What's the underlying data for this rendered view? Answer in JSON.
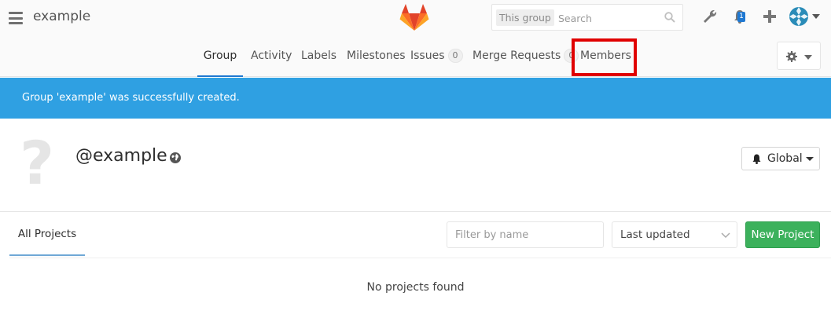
{
  "header": {
    "group_title": "example",
    "search": {
      "scope": "This group",
      "placeholder": "Search"
    },
    "todos_count": "1"
  },
  "subnav": {
    "tabs": [
      {
        "label": "Group",
        "active": true
      },
      {
        "label": "Activity"
      },
      {
        "label": "Labels"
      },
      {
        "label": "Milestones"
      },
      {
        "label": "Issues",
        "count": "0"
      },
      {
        "label": "Merge Requests",
        "count": "0"
      },
      {
        "label": "Members"
      }
    ]
  },
  "flash": {
    "message": "Group 'example' was successfully created."
  },
  "group": {
    "avatar_placeholder": "?",
    "name": "@example",
    "notification_level": "Global"
  },
  "projects": {
    "tab_label": "All Projects",
    "filter_placeholder": "Filter by name",
    "sort_label": "Last updated",
    "new_project_label": "New Project",
    "empty_message": "No projects found"
  },
  "colors": {
    "flash_bg": "#2fa0e2",
    "active_tab_underline": "#1f78d1",
    "new_project_bg": "#3cb15c",
    "highlight_box": "#e00000"
  }
}
